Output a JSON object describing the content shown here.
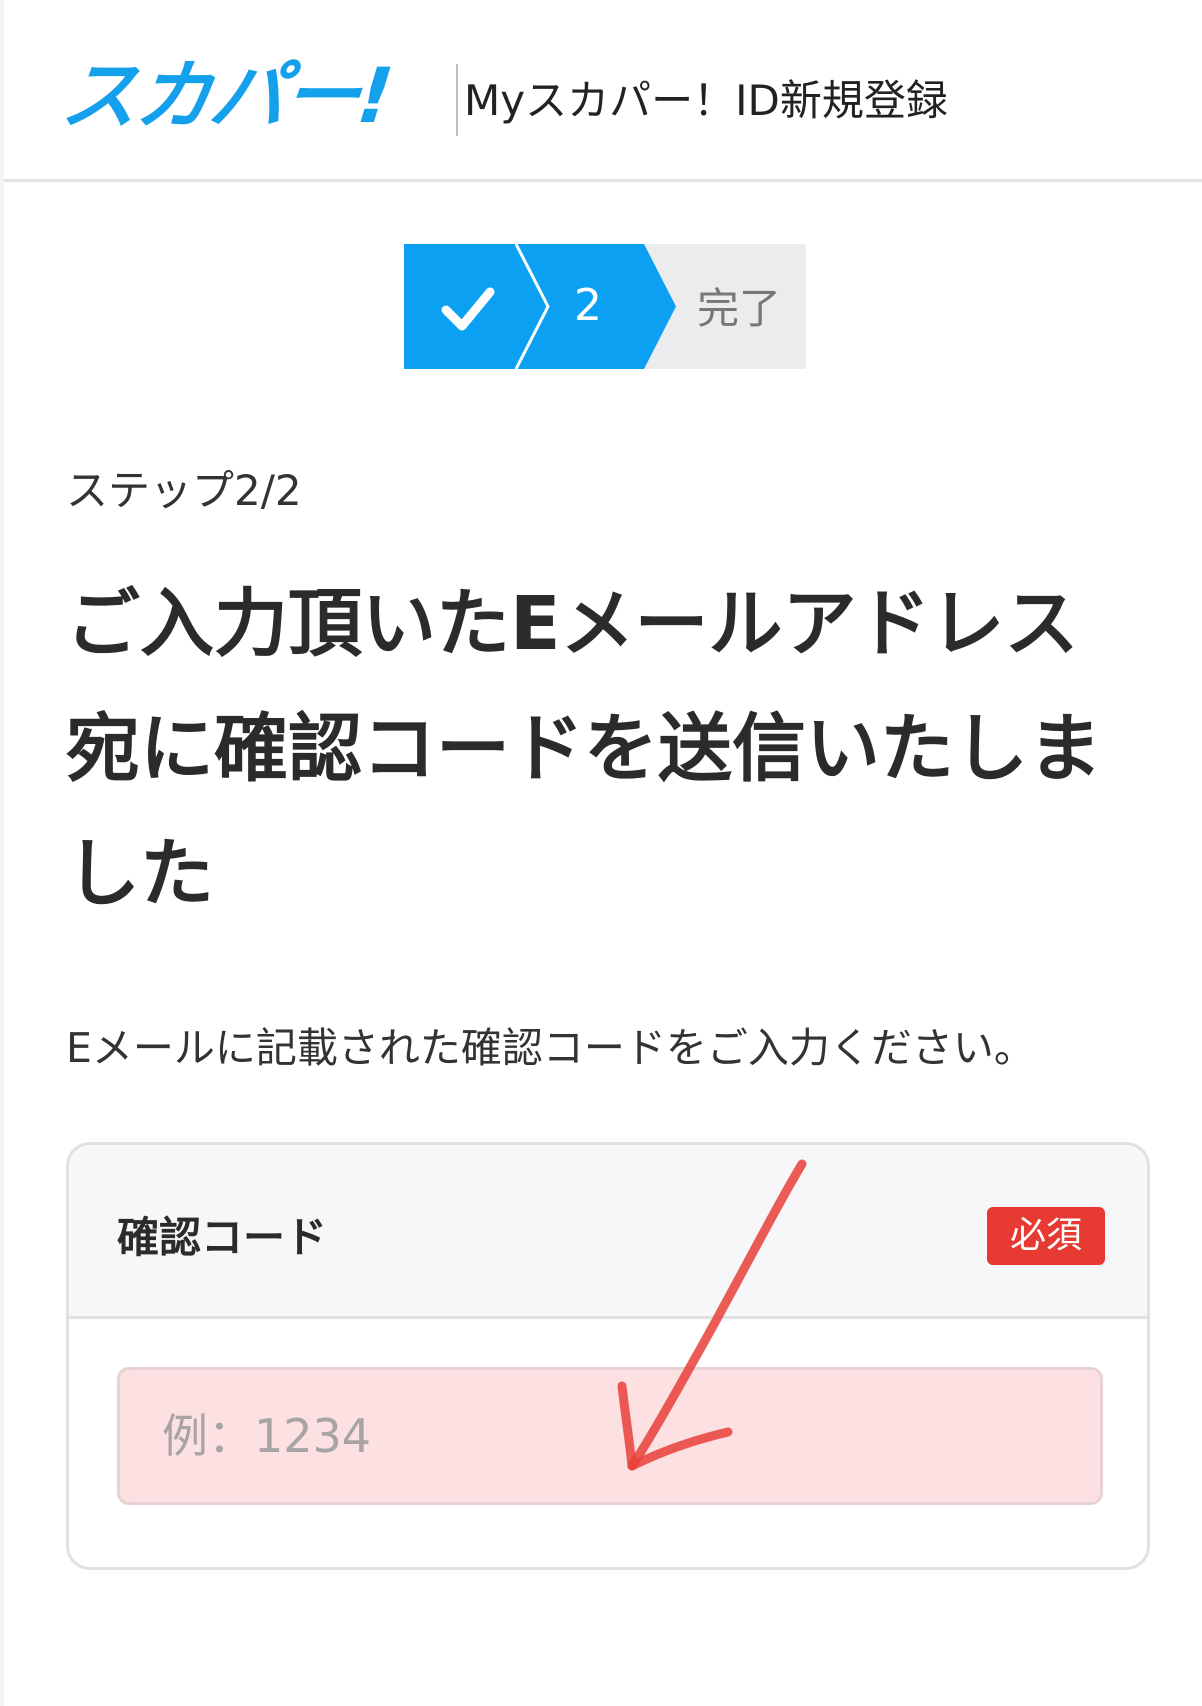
{
  "header": {
    "logo_text": "スカパー!",
    "title": "Myスカパー！ID新規登録"
  },
  "stepper": {
    "steps": [
      {
        "label": "✓",
        "state": "done"
      },
      {
        "label": "2",
        "state": "current"
      },
      {
        "label": "完了",
        "state": "upcoming"
      }
    ]
  },
  "content": {
    "step_indicator": "ステップ2/2",
    "heading": "ご入力頂いたEメールアドレス宛に確認コードを送信いたしました",
    "instruction": "Eメールに記載された確認コードをご入力ください。"
  },
  "form": {
    "field_label": "確認コード",
    "required_badge": "必須",
    "input_placeholder": "例：1234",
    "input_value": ""
  },
  "colors": {
    "brand_blue": "#15a0ec",
    "step_active": "#0ca0f2",
    "step_inactive": "#ececef",
    "required_red": "#e63a33",
    "input_error_bg": "#fde0e2",
    "annotation_arrow": "#e8403a"
  }
}
